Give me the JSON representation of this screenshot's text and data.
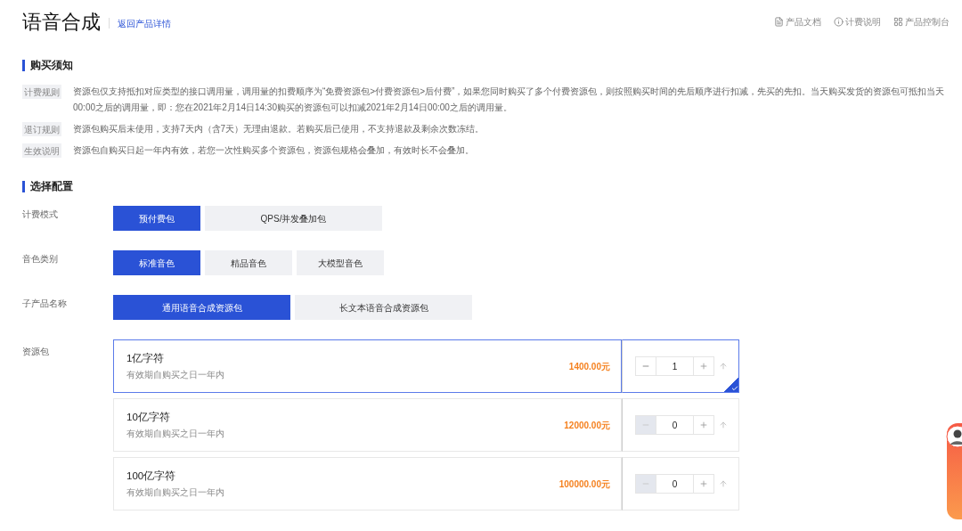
{
  "header": {
    "title": "语音合成",
    "back_link": "返回产品详情",
    "links": [
      {
        "kind": "doc",
        "label": "产品文档"
      },
      {
        "kind": "info",
        "label": "计费说明"
      },
      {
        "kind": "grid",
        "label": "产品控制台"
      }
    ]
  },
  "notice": {
    "title": "购买须知",
    "rules": [
      {
        "tag": "计费规则",
        "text": "资源包仅支持抵扣对应类型的接口调用量，调用量的扣费顺序为“免费资源包>付费资源包>后付费”，如果您同时购买了多个付费资源包，则按照购买时间的先后顺序进行扣减，先买的先扣。当天购买发货的资源包可抵扣当天00:00之后的调用量，即：您在2021年2月14日14:30购买的资源包可以扣减2021年2月14日00:00之后的调用量。"
      },
      {
        "tag": "退订规则",
        "text": "资源包购买后未使用，支持7天内（含7天）无理由退款。若购买后已使用，不支持退款及剩余次数冻结。"
      },
      {
        "tag": "生效说明",
        "text": "资源包自购买日起一年内有效，若您一次性购买多个资源包，资源包规格会叠加，有效时长不会叠加。"
      }
    ]
  },
  "config": {
    "title": "选择配置",
    "rows": [
      {
        "label": "计费模式",
        "options": [
          {
            "label": "预付费包",
            "kind": "normal",
            "selected": true
          },
          {
            "label": "QPS/并发叠加包",
            "kind": "wide",
            "selected": false
          }
        ]
      },
      {
        "label": "音色类别",
        "options": [
          {
            "label": "标准音色",
            "kind": "normal",
            "selected": true
          },
          {
            "label": "精品音色",
            "kind": "normal",
            "selected": false
          },
          {
            "label": "大模型音色",
            "kind": "normal",
            "selected": false
          }
        ]
      },
      {
        "label": "子产品名称",
        "options": [
          {
            "label": "通用语音合成资源包",
            "kind": "wide",
            "selected": true
          },
          {
            "label": "长文本语音合成资源包",
            "kind": "wide",
            "selected": false
          }
        ]
      }
    ],
    "packages_label": "资源包",
    "packages": [
      {
        "name": "1亿字符",
        "validity": "有效期自购买之日一年内",
        "price": "1400.00元",
        "quantity": "1",
        "minus_disabled": false,
        "selected": true
      },
      {
        "name": "10亿字符",
        "validity": "有效期自购买之日一年内",
        "price": "12000.00元",
        "quantity": "0",
        "minus_disabled": true,
        "selected": false
      },
      {
        "name": "100亿字符",
        "validity": "有效期自购买之日一年内",
        "price": "100000.00元",
        "quantity": "0",
        "minus_disabled": true,
        "selected": false
      }
    ]
  }
}
